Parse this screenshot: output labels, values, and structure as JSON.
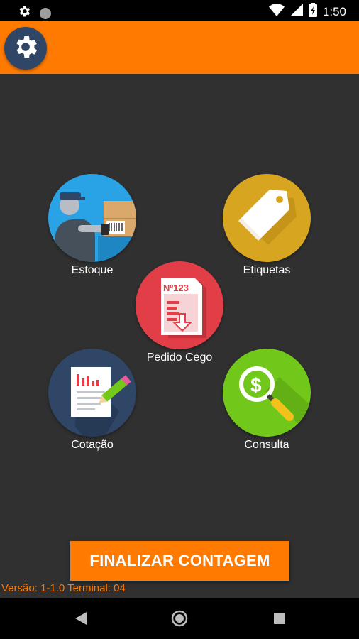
{
  "status_bar": {
    "time": "1:50",
    "icons": [
      "settings-icon",
      "circle-icon",
      "wifi-icon",
      "signal-icon",
      "battery-icon"
    ]
  },
  "app_bar": {
    "settings_icon": "gear-icon",
    "color": "#ff7a00"
  },
  "menu": {
    "items": [
      {
        "label": "Estoque",
        "icon": "warehouse-worker-icon",
        "color": "#29a3e6"
      },
      {
        "label": "Etiquetas",
        "icon": "tags-icon",
        "color": "#d8a520"
      },
      {
        "label": "Pedido Cego",
        "icon": "document-download-icon",
        "color": "#e23e48",
        "badge_text": "Nº123"
      },
      {
        "label": "Cotação",
        "icon": "document-chart-pencil-icon",
        "color": "#2f4666"
      },
      {
        "label": "Consulta",
        "icon": "magnifier-dollar-icon",
        "color": "#72c81a"
      }
    ]
  },
  "footer": {
    "finalize_button": "FINALIZAR CONTAGEM",
    "version_text": "Versão: 1-1.0 Terminal: 04"
  },
  "nav_bar": {
    "buttons": [
      "back-icon",
      "home-icon",
      "recents-icon"
    ]
  }
}
